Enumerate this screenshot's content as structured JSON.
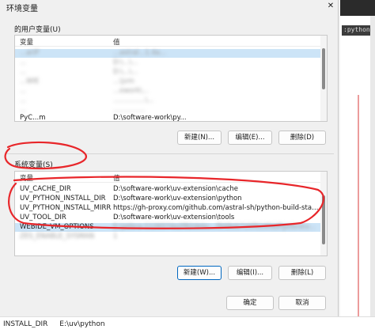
{
  "dialog": {
    "title": "环境变量",
    "close_glyph": "✕"
  },
  "user_section": {
    "label": "的用户变量(U)",
    "col_var": "变量",
    "col_val": "值",
    "rows": [
      {
        "name": "...ariP",
        "value": "...astral...1.4a..."
      },
      {
        "name": "...",
        "value": "D:\\...\\..."
      },
      {
        "name": "...",
        "value": "D:\\...\\..."
      },
      {
        "name": "...WIE",
        "value": "...\\jvm"
      },
      {
        "name": "...",
        "value": "...ework\\..."
      },
      {
        "name": "...",
        "value": "...............\\..."
      },
      {
        "name": "...",
        "value": "..............."
      },
      {
        "name": "PyC...m",
        "value": "D:\\software-work\\py..."
      }
    ],
    "buttons": {
      "new": "新建(N)...",
      "edit": "编辑(E)...",
      "delete": "删除(D)"
    }
  },
  "system_section": {
    "label": "系统变量(S)",
    "col_var": "变量",
    "col_val": "值",
    "rows": [
      {
        "name": "UV_CACHE_DIR",
        "value": "D:\\software-work\\uv-extension\\cache"
      },
      {
        "name": "UV_PYTHON_INSTALL_DIR",
        "value": "D:\\software-work\\uv-extension\\python"
      },
      {
        "name": "UV_PYTHON_INSTALL_MIRR...",
        "value": "https://gh-proxy.com/github.com/astral-sh/python-build-standal..."
      },
      {
        "name": "UV_TOOL_DIR",
        "value": "D:\\software-work\\uv-extension\\tools"
      },
      {
        "name": "WEBIDE_VM_OPTIONS",
        "value": "E:\\jetbra-1126574a2f82debc...f948eb7d4f616fddf\\jetbra\\v..."
      },
      {
        "name": "ZES_ENABLE_SYSMAN",
        "value": "1"
      }
    ],
    "buttons": {
      "new": "新建(W)...",
      "edit": "编辑(I)...",
      "delete": "删除(L)"
    }
  },
  "footer": {
    "ok": "确定",
    "cancel": "取消"
  },
  "background": {
    "right_code": ":python-b",
    "bottom_var": "INSTALL_DIR",
    "bottom_val": "E:\\uv\\python"
  },
  "colors": {
    "selection": "#cce4f7",
    "annotation": "#e8262a",
    "primary_border": "#0067c0"
  }
}
